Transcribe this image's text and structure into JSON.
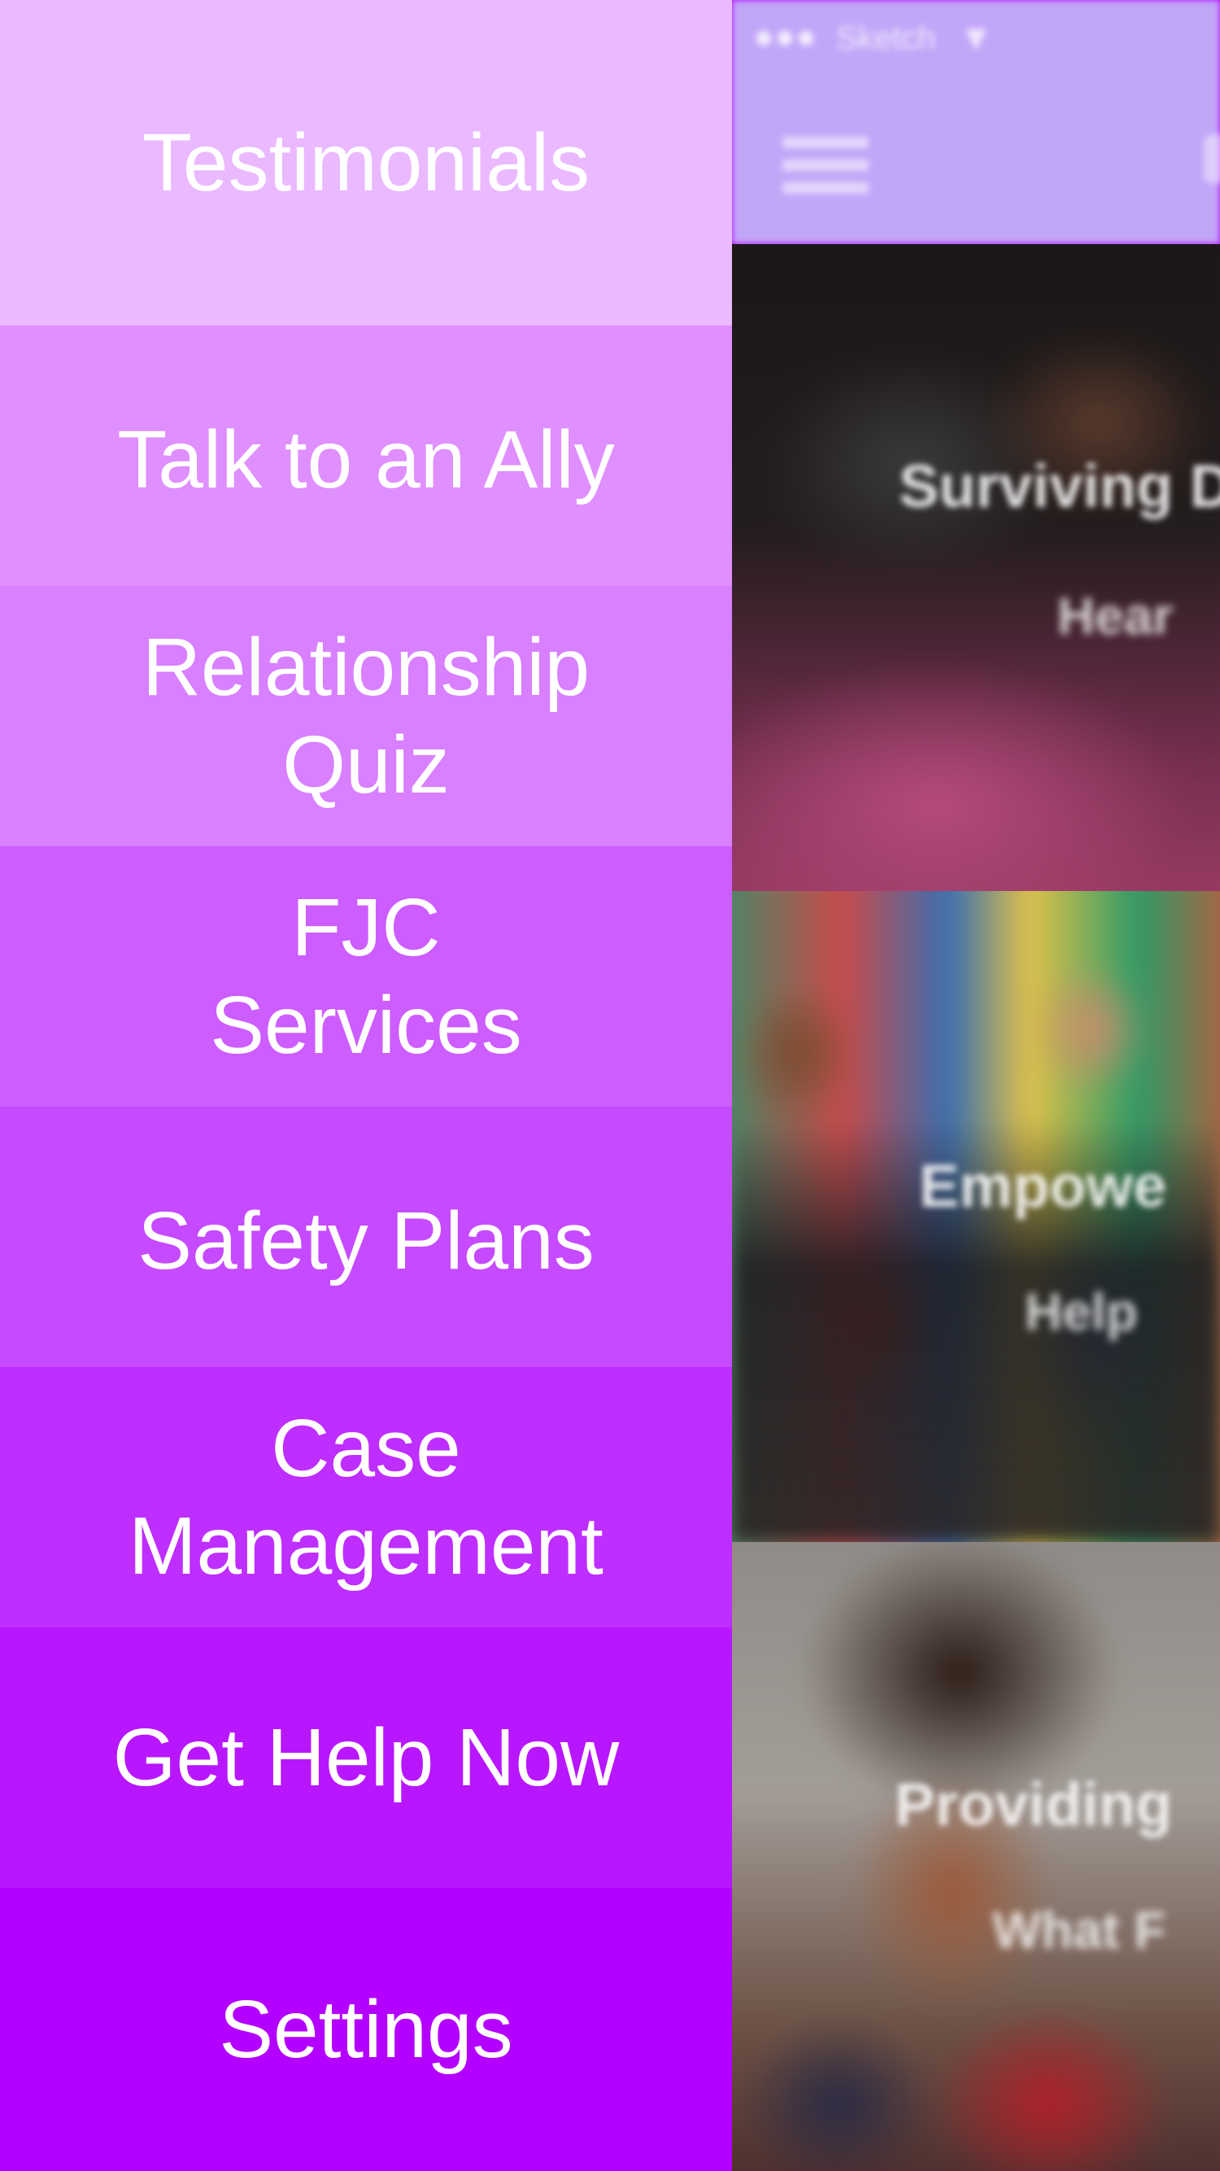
{
  "status_bar": {
    "carrier": "Sketch"
  },
  "menu": {
    "items": [
      {
        "label": "Testimonials",
        "color": "#eab9ff"
      },
      {
        "label": "Talk to an Ally",
        "color": "#e08fff"
      },
      {
        "label": "Relationship\nQuiz",
        "color": "#d880ff"
      },
      {
        "label": "FJC\nServices",
        "color": "#cd5dff"
      },
      {
        "label": "Safety Plans",
        "color": "#c64aff"
      },
      {
        "label": "Case\nManagement",
        "color": "#be2eff"
      },
      {
        "label": "Get Help Now",
        "color": "#b816ff"
      },
      {
        "label": "Settings",
        "color": "#b300ff"
      }
    ]
  },
  "background_app": {
    "header_color": "#c2a6f8",
    "cards": [
      {
        "title": "Surviving D",
        "subtitle": "Hear"
      },
      {
        "title": "Empowe",
        "subtitle": "Help"
      },
      {
        "title": "Providing",
        "subtitle": "What F"
      }
    ]
  }
}
